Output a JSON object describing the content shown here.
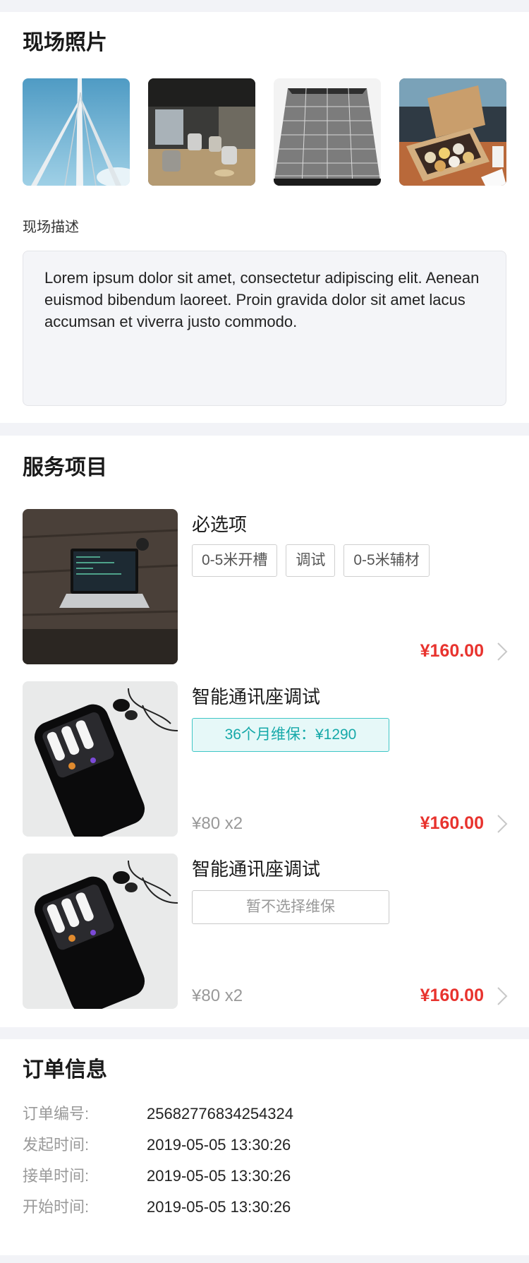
{
  "photos": {
    "title": "现场照片",
    "images": [
      {
        "icon": "tower-photo"
      },
      {
        "icon": "office-photo"
      },
      {
        "icon": "building-photo"
      },
      {
        "icon": "food-box-photo"
      }
    ],
    "desc_label": "现场描述",
    "desc_text": "Lorem ipsum dolor sit amet, consectetur adipiscing elit. Aenean euismod bibendum laoreet. Proin gravida dolor sit amet lacus accumsan et viverra justo commodo."
  },
  "services": {
    "title": "服务项目",
    "items": [
      {
        "name": "必选项",
        "tags": [
          "0-5米开槽",
          "调试",
          "0-5米辅材"
        ],
        "price": "¥160.00",
        "image": "laptop-photo"
      },
      {
        "name": "智能通讯座调试",
        "warranty": "36个月维保：¥1290",
        "qty": "¥80 x2",
        "price": "¥160.00",
        "image": "phone-photo"
      },
      {
        "name": "智能通讯座调试",
        "warranty": "暂不选择维保",
        "qty": "¥80 x2",
        "price": "¥160.00",
        "image": "phone-photo"
      }
    ]
  },
  "order": {
    "title": "订单信息",
    "rows": [
      {
        "label": "订单编号:",
        "value": "25682776834254324"
      },
      {
        "label": "发起时间:",
        "value": "2019-05-05 13:30:26"
      },
      {
        "label": "接单时间:",
        "value": "2019-05-05 13:30:26"
      },
      {
        "label": "开始时间:",
        "value": "2019-05-05 13:30:26"
      }
    ]
  },
  "colors": {
    "price": "#e8332e",
    "accent": "#16a9a9",
    "background": "#f2f3f7"
  }
}
